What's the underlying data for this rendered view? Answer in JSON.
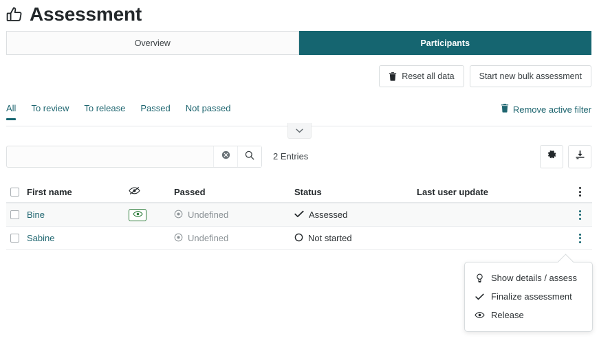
{
  "header": {
    "icon": "thumbs-up-icon",
    "title": "Assessment"
  },
  "top_tabs": [
    {
      "label": "Overview",
      "active": false
    },
    {
      "label": "Participants",
      "active": true
    }
  ],
  "actions": [
    {
      "label": "Reset all data",
      "icon": "trash-icon"
    },
    {
      "label": "Start new bulk assessment",
      "icon": ""
    }
  ],
  "filters": {
    "items": [
      {
        "label": "All",
        "active": true
      },
      {
        "label": "To review",
        "active": false
      },
      {
        "label": "To release",
        "active": false
      },
      {
        "label": "Passed",
        "active": false
      },
      {
        "label": "Not passed",
        "active": false
      }
    ],
    "remove_label": "Remove active filter",
    "remove_icon": "trash-icon"
  },
  "collapse_icon": "chevron-down-icon",
  "search": {
    "value": "",
    "placeholder": "",
    "clear_icon": "circle-x-icon",
    "search_icon": "search-icon"
  },
  "entries_label": "2 Entries",
  "tools": [
    {
      "name": "settings",
      "icon": "gear-icon"
    },
    {
      "name": "export",
      "icon": "download-icon"
    }
  ],
  "table": {
    "columns": [
      {
        "label": "",
        "key": "select"
      },
      {
        "label": "First name",
        "key": "first_name"
      },
      {
        "label": "",
        "key": "visibility",
        "icon": "eye-slash-icon"
      },
      {
        "label": "Passed",
        "key": "passed"
      },
      {
        "label": "Status",
        "key": "status"
      },
      {
        "label": "Last user update",
        "key": "last_user_update"
      },
      {
        "label": "",
        "key": "actions",
        "icon": "kebab-icon"
      }
    ],
    "rows": [
      {
        "first_name": "Bine",
        "visibility_badge": true,
        "visibility_icon": "eye-icon",
        "passed": "Undefined",
        "passed_icon": "dot-circle-icon",
        "status": "Assessed",
        "status_icon": "check-icon",
        "last_user_update": "",
        "highlighted": true
      },
      {
        "first_name": "Sabine",
        "visibility_badge": false,
        "visibility_icon": "",
        "passed": "Undefined",
        "passed_icon": "dot-circle-icon",
        "status": "Not started",
        "status_icon": "circle-icon",
        "last_user_update": "",
        "highlighted": false
      }
    ]
  },
  "popup_menu": {
    "items": [
      {
        "label": "Show details / assess",
        "icon": "magnifier-icon"
      },
      {
        "label": "Finalize assessment",
        "icon": "check-icon"
      },
      {
        "label": "Release",
        "icon": "eye-icon"
      }
    ]
  },
  "colors": {
    "accent_teal": "#156570",
    "link_teal": "#1f6670",
    "green_badge": "#2e7d3c",
    "muted_gray": "#8b9296",
    "text_dark": "#23282b"
  }
}
